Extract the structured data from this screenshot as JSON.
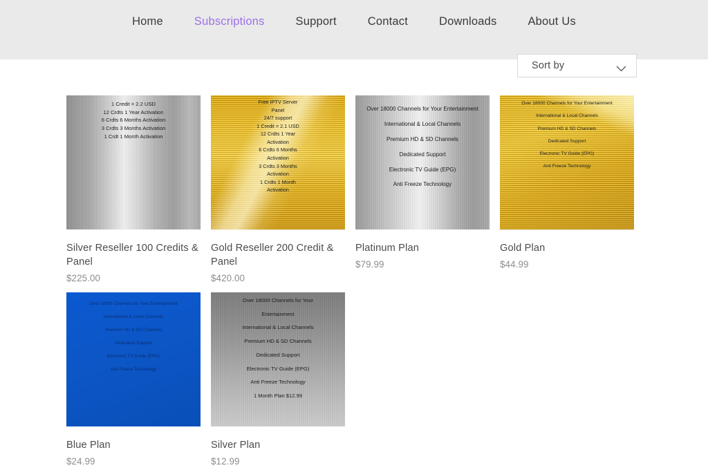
{
  "header": {
    "nav": [
      {
        "label": "Home",
        "active": false
      },
      {
        "label": "Subscriptions",
        "active": true
      },
      {
        "label": "Support",
        "active": false
      },
      {
        "label": "Contact",
        "active": false
      },
      {
        "label": "Downloads",
        "active": false
      },
      {
        "label": "About Us",
        "active": false
      }
    ],
    "background": "#eaeaea",
    "accent_color": "#9b6fe8",
    "link_color": "#3a3a3a"
  },
  "toolbar": {
    "sort": {
      "label": "Sort by",
      "icon": "chevron-down-icon"
    }
  },
  "products": [
    {
      "title": "Silver Reseller 100 Credits & Panel",
      "price": "$225.00",
      "surface": "surf-silver-reseller",
      "image_lines": [
        "1 Credit = 2.2 USD",
        "12 Crdts 1 Year Activation",
        "6 Crdts 6 Months Activation",
        "3 Crdts 3 Months Activation",
        "1 Crdt 1 Month Activation"
      ]
    },
    {
      "title": "Gold Reseller 200 Credit & Panel",
      "price": "$420.00",
      "surface": "surf-gold-reseller",
      "image_lines": [
        "Free IPTV Server",
        "Panel",
        "24/7 support",
        "1 Credit = 2.1 USD",
        "12 Crdts 1 Year",
        "Activation",
        "6 Crdts 6 Months",
        "Activation",
        "3 Crdts 3 Months",
        "Activation",
        "1 Crdts 1 Month",
        "Activation"
      ]
    },
    {
      "title": "Platinum Plan",
      "price": "$79.99",
      "surface": "surf-platinum",
      "image_lines": [
        "Over 18000 Channels for Your Entertainment",
        "International & Local Channels",
        "Premium HD & SD Channels",
        "Dedicated Support",
        "Electronic TV Guide (EPG)",
        "Anti Freeze Technology"
      ]
    },
    {
      "title": "Gold Plan",
      "price": "$44.99",
      "surface": "surf-gold-plan",
      "image_lines": [
        "Over 18000 Channels for Your Entertainment",
        "International & Local Channels",
        "Premium HD & SD Channels",
        "Dedicated Support",
        "Electronic TV Guide (EPG)",
        "Anti Freeze Technology"
      ]
    },
    {
      "title": "Blue Plan",
      "price": "$24.99",
      "surface": "surf-blue",
      "image_lines": [
        "Over 18000 Channels for Your Entertainment",
        "International & Local Channels",
        "Premium HD & SD Channels",
        "Dedicated Support",
        "Electronic TV Guide (EPG)",
        "Anti Freeze Technology"
      ]
    },
    {
      "title": "Silver Plan",
      "price": "$12.99",
      "surface": "surf-silver-plan",
      "image_lines": [
        "Over 18000 Channels for Your",
        "Entertainment",
        "International & Local Channels",
        "Premium HD & SD Channels",
        "Dedicated Support",
        "Electronic TV Guide (EPG)",
        "Anti Freeze Technology",
        "1 Month Plan $12.99"
      ]
    }
  ]
}
